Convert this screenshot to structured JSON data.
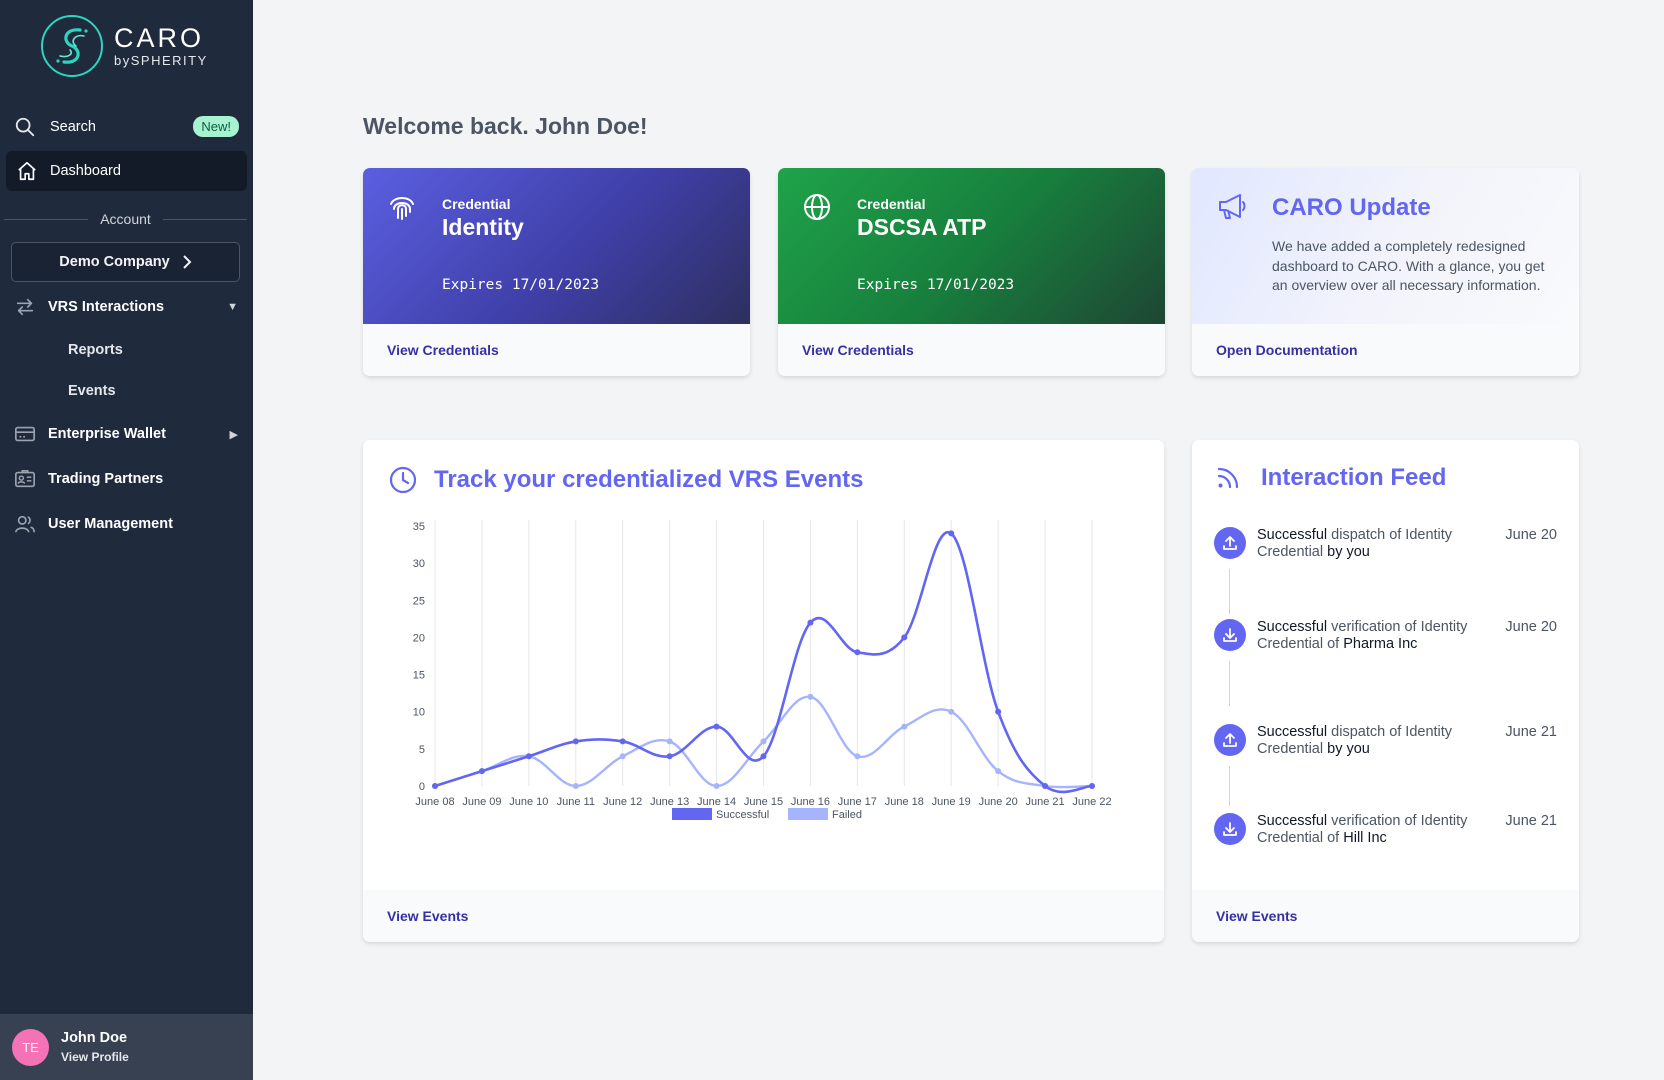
{
  "brand": {
    "name": "CARO",
    "by": "by",
    "company": "SPHERITY"
  },
  "colors": {
    "sidebar": "#1f2a3d",
    "accent": "#6366f1",
    "link": "#3730a3",
    "identity_card": "#4f46e5",
    "dscsa_card": "#16a34a"
  },
  "sidebar": {
    "search": {
      "label": "Search",
      "badge": "New!"
    },
    "dashboard": "Dashboard",
    "account_label": "Account",
    "company": "Demo Company",
    "vrs": {
      "label": "VRS Interactions",
      "items": [
        "Reports",
        "Events"
      ]
    },
    "enterprise_wallet": "Enterprise Wallet",
    "trading_partners": "Trading Partners",
    "user_management": "User Management",
    "profile": {
      "initials": "TE",
      "name": "John Doe",
      "link": "View Profile"
    }
  },
  "welcome": "Welcome back. John Doe!",
  "cards": [
    {
      "small": "Credential",
      "title": "Identity",
      "expires": "Expires 17/01/2023",
      "link": "View Credentials",
      "icon": "fingerprint-icon"
    },
    {
      "small": "Credential",
      "title": "DSCSA ATP",
      "expires": "Expires 17/01/2023",
      "link": "View Credentials",
      "icon": "globe-icon"
    }
  ],
  "update": {
    "title": "CARO Update",
    "body": "We have added a completely redesigned dashboard to CARO. With a glance, you get an overview over all necessary information.",
    "link": "Open Documentation",
    "icon": "megaphone-icon"
  },
  "events_panel": {
    "title": "Track your credentialized VRS Events",
    "link": "View Events",
    "icon": "clock-icon"
  },
  "feed": {
    "title": "Interaction Feed",
    "link": "View Events",
    "icon": "rss-icon",
    "items": [
      {
        "status": "Successful",
        "action": " dispatch of Identity Credential ",
        "party": "by you",
        "date": "June 20",
        "icon": "upload-icon"
      },
      {
        "status": "Successful",
        "action": " verification of Identity Credential of ",
        "party": "Pharma Inc",
        "date": "June 20",
        "icon": "download-icon"
      },
      {
        "status": "Successful",
        "action": " dispatch of Identity Credential ",
        "party": "by you",
        "date": "June 21",
        "icon": "upload-icon"
      },
      {
        "status": "Successful",
        "action": " verification of Identity Credential of ",
        "party": "Hill Inc",
        "date": "June 21",
        "icon": "download-icon"
      }
    ]
  },
  "chart_data": {
    "type": "line",
    "categories": [
      "June 08",
      "June 09",
      "June 10",
      "June 11",
      "June 12",
      "June 13",
      "June 14",
      "June 15",
      "June 16",
      "June 17",
      "June 18",
      "June 19",
      "June 20",
      "June 21",
      "June 22"
    ],
    "series": [
      {
        "name": "Successful",
        "color": "#6366f1",
        "values": [
          0,
          2,
          4,
          6,
          6,
          4,
          8,
          4,
          22,
          18,
          20,
          34,
          10,
          0,
          0
        ]
      },
      {
        "name": "Failed",
        "color": "#a5b4fc",
        "values": [
          0,
          2,
          4,
          0,
          4,
          6,
          0,
          6,
          12,
          4,
          8,
          10,
          2,
          0,
          0
        ]
      }
    ],
    "yticks": [
      0,
      5,
      10,
      15,
      20,
      25,
      30,
      35
    ],
    "ylim": [
      0,
      35
    ],
    "grid": "vertical",
    "legend": "bottom-center",
    "title": "",
    "xlabel": "",
    "ylabel": ""
  }
}
